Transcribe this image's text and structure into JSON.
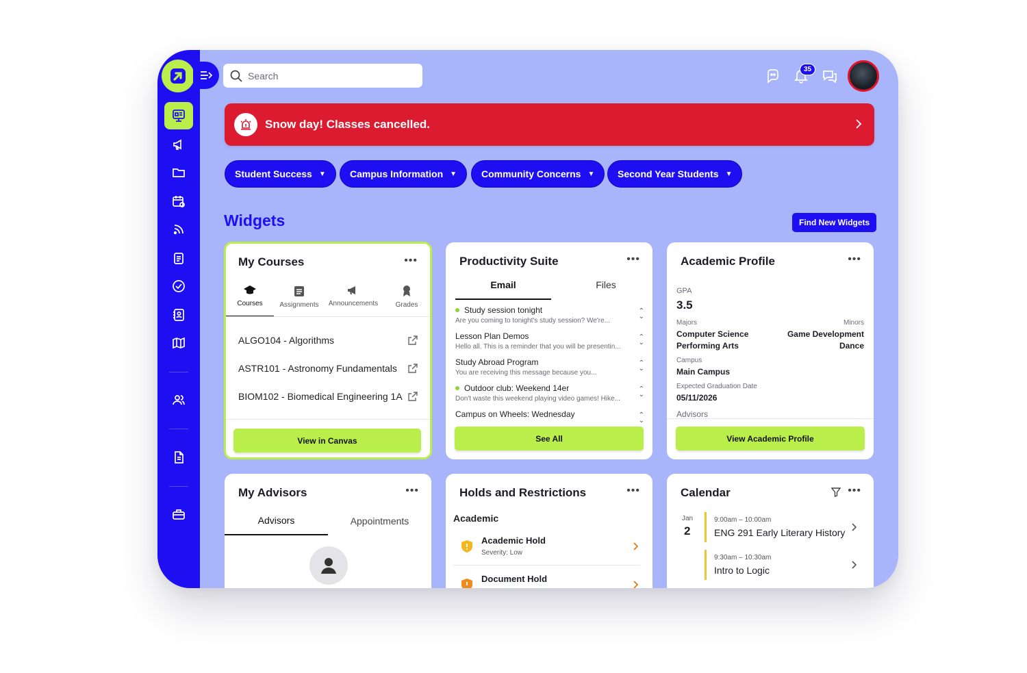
{
  "search": {
    "placeholder": "Search"
  },
  "notifications": {
    "count": "35"
  },
  "alert": {
    "text": "Snow day! Classes cancelled."
  },
  "filters": [
    {
      "label": "Student Success"
    },
    {
      "label": "Campus Information"
    },
    {
      "label": "Community Concerns"
    },
    {
      "label": "Second Year Students"
    }
  ],
  "widgets": {
    "title": "Widgets",
    "find_label": "Find New Widgets"
  },
  "my_courses": {
    "title": "My Courses",
    "tabs": [
      {
        "label": "Courses",
        "icon": "graduation-cap-icon"
      },
      {
        "label": "Assignments",
        "icon": "clipboard-icon"
      },
      {
        "label": "Announcements",
        "icon": "megaphone-icon"
      },
      {
        "label": "Grades",
        "icon": "award-icon"
      }
    ],
    "courses": [
      {
        "name": "ALGO104 - Algorithms"
      },
      {
        "name": "ASTR101 - Astronomy Fundamentals"
      },
      {
        "name": "BIOM102 - Biomedical Engineering 1A"
      }
    ],
    "button": "View in Canvas"
  },
  "productivity": {
    "title": "Productivity Suite",
    "tabs": [
      {
        "label": "Email"
      },
      {
        "label": "Files"
      }
    ],
    "emails": [
      {
        "subject": "Study session tonight",
        "preview": "Are you coming to tonight's study session? We're...",
        "unread": true
      },
      {
        "subject": "Lesson Plan Demos",
        "preview": "Hello all. This is a reminder that you will be presentin...",
        "unread": false
      },
      {
        "subject": "Study Abroad Program",
        "preview": "You are receiving this message because you...",
        "unread": false
      },
      {
        "subject": "Outdoor club: Weekend 14er",
        "preview": "Don't waste this weekend playing video games! Hike...",
        "unread": true
      },
      {
        "subject": "Campus on Wheels: Wednesday",
        "preview": "",
        "unread": false
      }
    ],
    "button": "See All"
  },
  "academic": {
    "title": "Academic Profile",
    "gpa_label": "GPA",
    "gpa": "3.5",
    "majors_label": "Majors",
    "minors_label": "Minors",
    "majors": [
      "Computer Science",
      "Performing Arts"
    ],
    "minors": [
      "Game Development",
      "Dance"
    ],
    "campus_label": "Campus",
    "campus": "Main Campus",
    "grad_label": "Expected Graduation Date",
    "grad": "05/11/2026",
    "advisors_label": "Advisors",
    "button": "View Academic Profile"
  },
  "advisors": {
    "title": "My Advisors",
    "tabs": [
      {
        "label": "Advisors"
      },
      {
        "label": "Appointments"
      }
    ]
  },
  "holds": {
    "title": "Holds and Restrictions",
    "section": "Academic",
    "items": [
      {
        "name": "Academic Hold",
        "severity": "Severity: Low"
      },
      {
        "name": "Document Hold",
        "severity": ""
      }
    ]
  },
  "calendar": {
    "title": "Calendar",
    "month": "Jan",
    "day": "2",
    "events": [
      {
        "time": "9:00am – 10:00am",
        "name": "ENG 291 Early Literary History"
      },
      {
        "time": "9:30am – 10:30am",
        "name": "Intro to Logic"
      }
    ]
  },
  "colors": {
    "brand": "#1e0ff2",
    "accent": "#b9ee4b",
    "alert": "#dc1a30",
    "background": "#a9b5fb"
  }
}
